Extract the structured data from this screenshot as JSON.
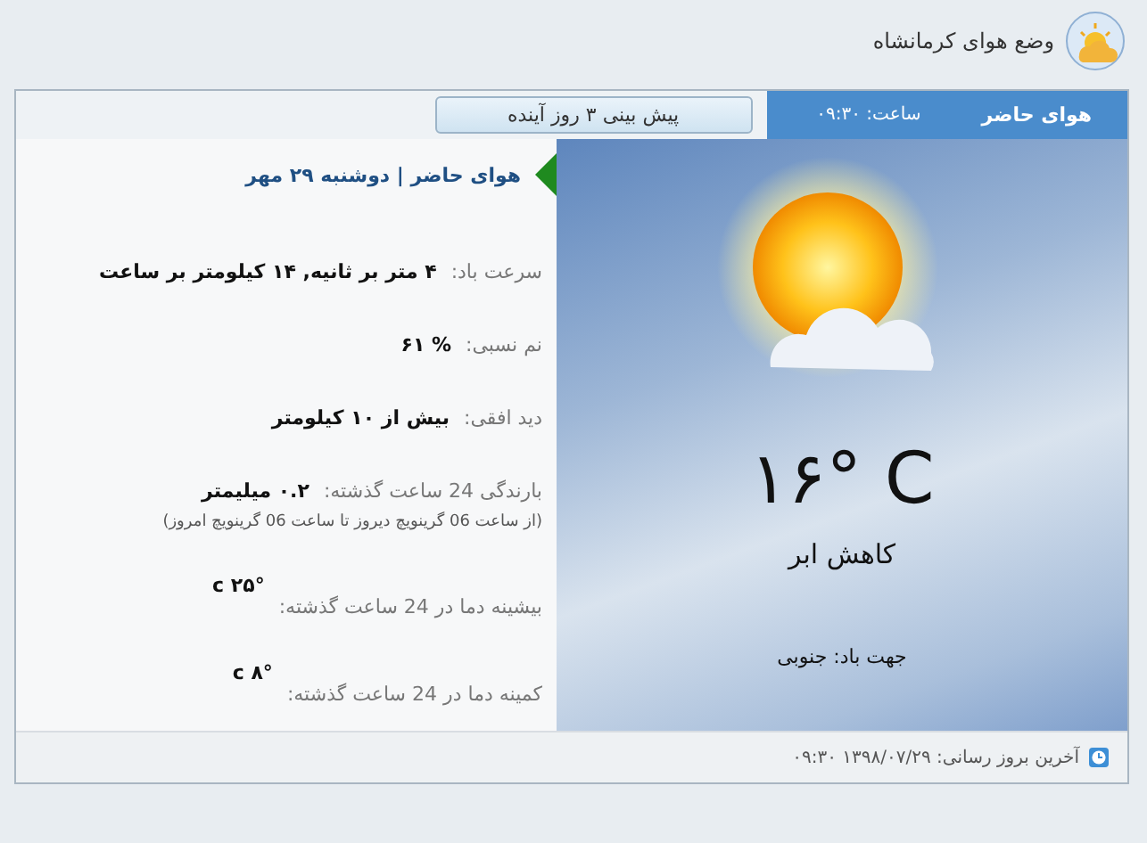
{
  "header": {
    "title": "وضع هوای کرمانشاه"
  },
  "tabs": [
    {
      "label": "هوای حاضر",
      "selected": true
    },
    {
      "label": "پیش بینی ۳ روز آینده",
      "selected": false
    }
  ],
  "time": "ساعت: ۰۹:۳۰",
  "details": {
    "heading": "هوای حاضر | دوشنبه ۲۹ مهر",
    "rows": [
      {
        "kind": "plain",
        "label": "سرعت باد:",
        "value": "۴ متر بر ثانیه, ۱۴ کیلومتر بر ساعت"
      },
      {
        "kind": "plain",
        "label": "نم نسبی:",
        "value": "% ۶۱"
      },
      {
        "kind": "plain",
        "label": "دید افقی:",
        "value": "بیش از ۱۰ کیلومتر"
      },
      {
        "kind": "plain",
        "label": "بارندگی 24 ساعت گذشته:",
        "value": "۰.۲ میلیمتر",
        "note": "(از ساعت 06 گرینویچ دیروز تا ساعت 06 گرینویچ امروز)"
      },
      {
        "kind": "raised",
        "label": "بیشینه دما در 24 ساعت گذشته:",
        "value": "۲۵° c"
      },
      {
        "kind": "raised",
        "label": "کمینه دما در 24 ساعت گذشته:",
        "value": "۸° c"
      }
    ]
  },
  "current": {
    "temperature": "۱۶° C",
    "condition": "کاهش ابر",
    "wind_direction": "جهت باد: جنوبی"
  },
  "footer": {
    "updated": "آخرین بروز رسانی: ۱۳۹۸/۰۷/۲۹ ۰۹:۳۰"
  }
}
